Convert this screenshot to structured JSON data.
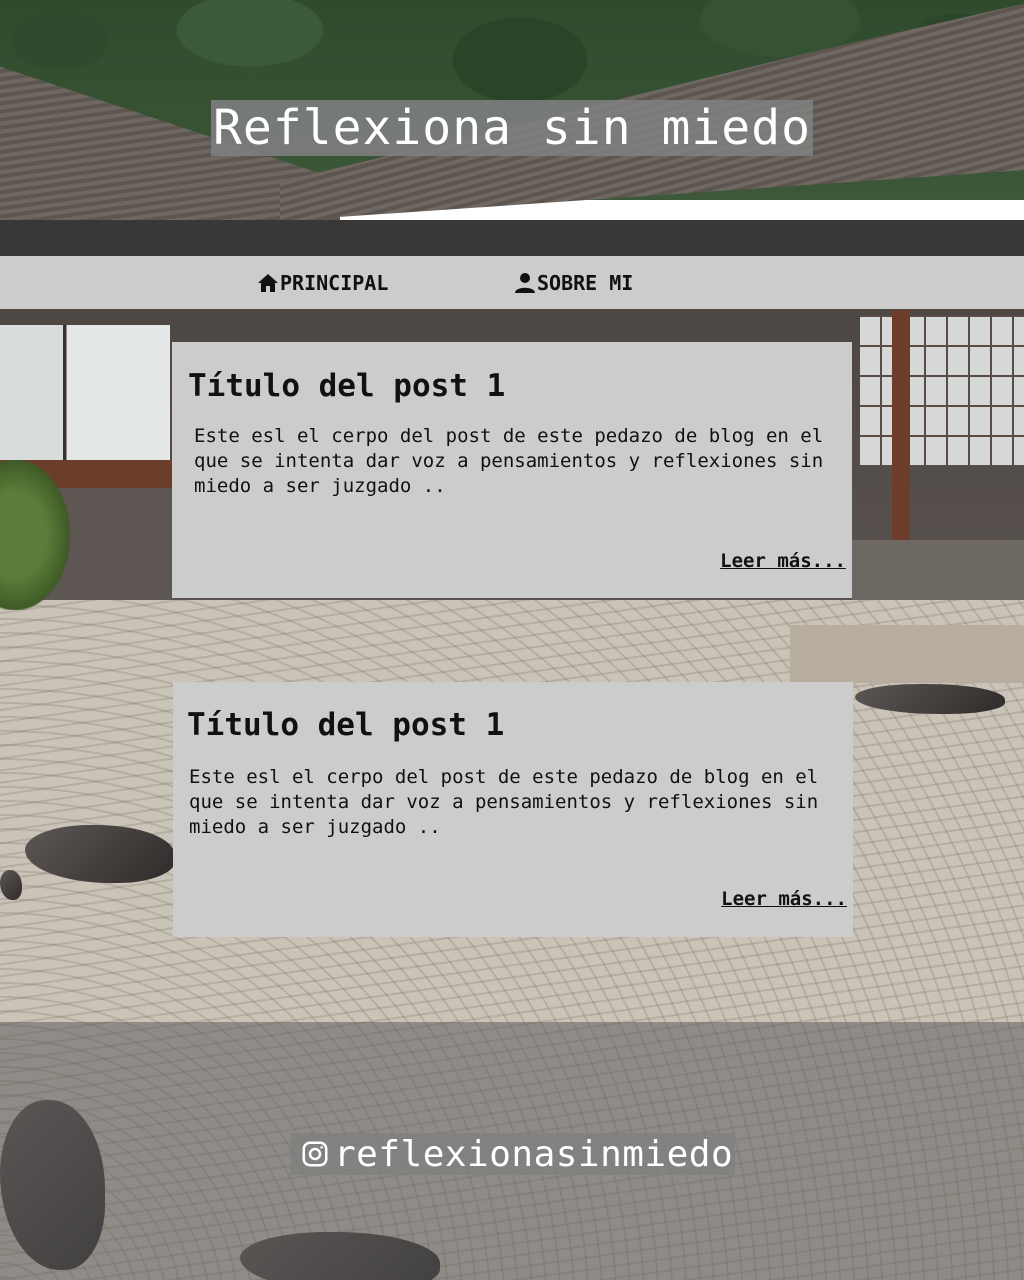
{
  "header": {
    "title": "Reflexiona sin miedo"
  },
  "nav": {
    "items": [
      {
        "label": "PRINCIPAL",
        "icon": "home-icon"
      },
      {
        "label": "SOBRE MI",
        "icon": "user-icon"
      }
    ]
  },
  "posts": [
    {
      "title": "Título del post 1",
      "body": "Este esl el cerpo del post de este pedazo de blog en el que se intenta dar voz a pensamientos y reflexiones sin miedo a ser juzgado ..",
      "read_more": "Leer más..."
    },
    {
      "title": "Título del post 1",
      "body": "Este esl el cerpo del post de este pedazo de blog en el que se intenta dar voz a pensamientos y reflexiones sin miedo a ser juzgado ..",
      "read_more": "Leer más..."
    }
  ],
  "footer": {
    "handle": "reflexionasinmiedo",
    "icon": "instagram-icon"
  },
  "colors": {
    "nav_bg": "#cccccc",
    "card_bg": "#cccccc",
    "title_bg": "#808080",
    "text": "#111111"
  }
}
